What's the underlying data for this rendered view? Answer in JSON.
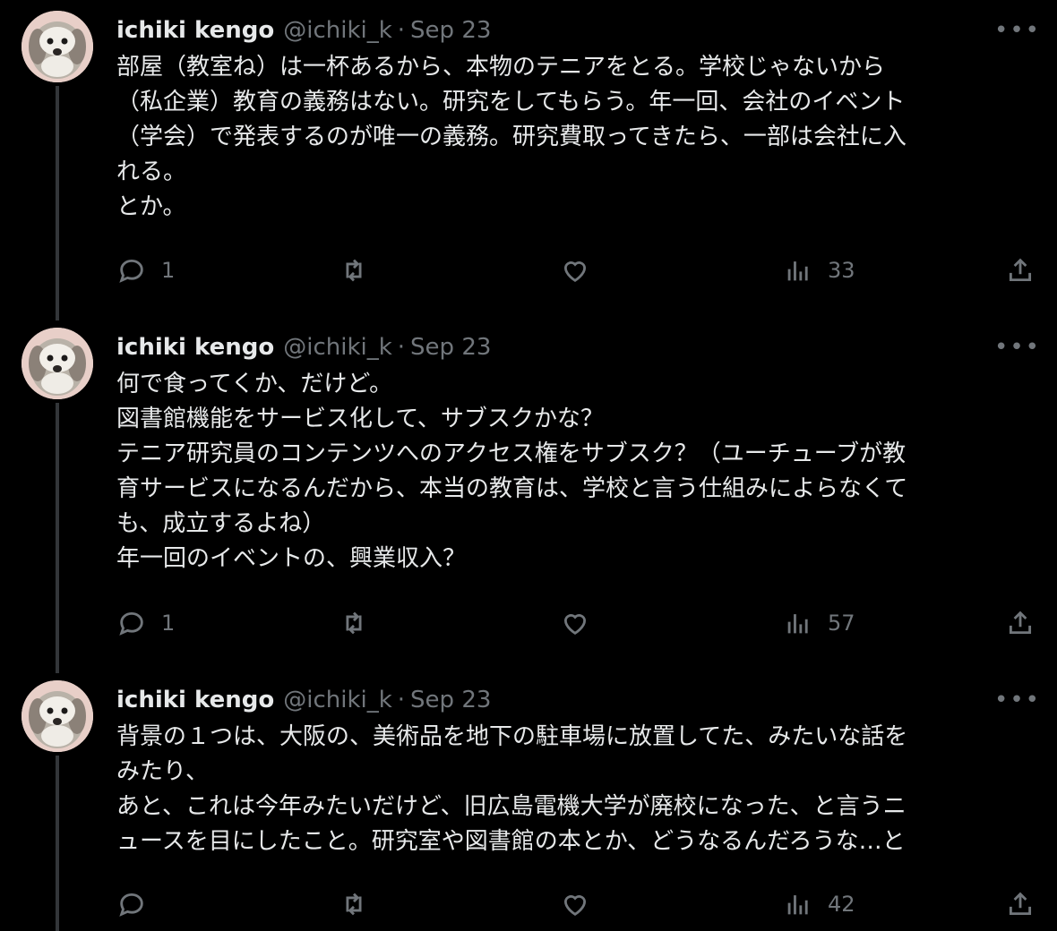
{
  "tweets": [
    {
      "author": {
        "name": "ichiki kengo",
        "handle": "@ichiki_k"
      },
      "separator": "·",
      "date": "Sep 23",
      "more_label": "•••",
      "lines": [
        "部屋（教室ね）は一杯あるから、本物のテニアをとる。学校じゃないから",
        "（私企業）教育の義務はない。研究をしてもらう。年一回、会社のイベント",
        "（学会）で発表するのが唯一の義務。研究費取ってきたら、一部は会社に入",
        "れる。",
        "とか。"
      ],
      "stats": {
        "replies": "1",
        "retweets": "",
        "likes": "",
        "views": "33"
      }
    },
    {
      "author": {
        "name": "ichiki kengo",
        "handle": "@ichiki_k"
      },
      "separator": "·",
      "date": "Sep 23",
      "more_label": "•••",
      "lines": [
        "何で食ってくか、だけど。",
        "図書館機能をサービス化して、サブスクかな？",
        "テニア研究員のコンテンツへのアクセス権をサブスク？（ユーチューブが教",
        "育サービスになるんだから、本当の教育は、学校と言う仕組みによらなくて",
        "も、成立するよね）",
        "年一回のイベントの、興業収入？"
      ],
      "stats": {
        "replies": "1",
        "retweets": "",
        "likes": "",
        "views": "57"
      }
    },
    {
      "author": {
        "name": "ichiki kengo",
        "handle": "@ichiki_k"
      },
      "separator": "·",
      "date": "Sep 23",
      "more_label": "•••",
      "lines": [
        "背景の１つは、大阪の、美術品を地下の駐車場に放置してた、みたいな話を",
        "みたり、",
        "あと、これは今年みたいだけど、旧広島電機大学が廃校になった、と言うニ",
        "ュースを目にしたこと。研究室や図書館の本とか、どうなるんだろうな…と"
      ],
      "stats": {
        "replies": "",
        "retweets": "",
        "likes": "",
        "views": "42"
      }
    }
  ],
  "icons": {
    "reply": "speech-bubble",
    "retweet": "two-arrows-loop",
    "like": "heart-outline",
    "views": "bar-chart",
    "share": "upload-arrow",
    "more": "three-dots"
  },
  "colors": {
    "background": "#000000",
    "text": "#e7e9ea",
    "secondary": "#71767b",
    "thread_line": "#333639"
  }
}
